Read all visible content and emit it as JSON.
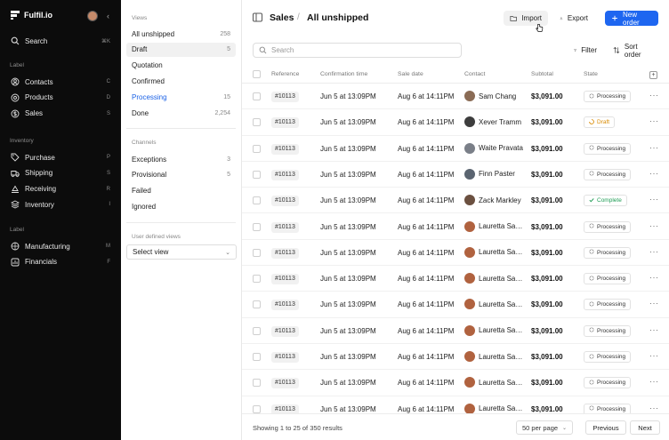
{
  "app": {
    "name": "Fulfil.io"
  },
  "sidebar": {
    "search": {
      "label": "Search",
      "shortcut": "⌘K"
    },
    "groups": [
      {
        "label": "Label",
        "items": [
          {
            "label": "Contacts",
            "shortcut": "C",
            "icon": "contacts-icon"
          },
          {
            "label": "Products",
            "shortcut": "D",
            "icon": "products-icon"
          },
          {
            "label": "Sales",
            "shortcut": "S",
            "icon": "sales-icon"
          }
        ]
      },
      {
        "label": "Inventory",
        "items": [
          {
            "label": "Purchase",
            "shortcut": "P",
            "icon": "tag-icon"
          },
          {
            "label": "Shipping",
            "shortcut": "S",
            "icon": "truck-icon"
          },
          {
            "label": "Receiving",
            "shortcut": "R",
            "icon": "receiving-icon"
          },
          {
            "label": "Inventory",
            "shortcut": "I",
            "icon": "stack-icon"
          }
        ]
      },
      {
        "label": "Label",
        "items": [
          {
            "label": "Manufacturing",
            "shortcut": "M",
            "icon": "factory-icon"
          },
          {
            "label": "Financials",
            "shortcut": "F",
            "icon": "chart-icon"
          }
        ]
      }
    ]
  },
  "views": {
    "views_label": "Views",
    "items": [
      {
        "label": "All unshipped",
        "count": "258"
      },
      {
        "label": "Draft",
        "count": "5"
      },
      {
        "label": "Quotation",
        "count": ""
      },
      {
        "label": "Confirmed",
        "count": ""
      },
      {
        "label": "Processing",
        "count": "15"
      },
      {
        "label": "Done",
        "count": "2,254"
      }
    ],
    "channels_label": "Channels",
    "channels": [
      {
        "label": "Exceptions",
        "count": "3"
      },
      {
        "label": "Provisional",
        "count": "5"
      },
      {
        "label": "Failed",
        "count": ""
      },
      {
        "label": "Ignored",
        "count": ""
      }
    ],
    "user_views_label": "User defined views",
    "select_view": "Select view"
  },
  "header": {
    "section": "Sales",
    "separator": "/",
    "title": "All unshipped",
    "import_label": "Import",
    "export_label": "Export",
    "new_order_label": "New order",
    "search_placeholder": "Search",
    "filter_label": "Filter",
    "sort_label": "Sort order"
  },
  "table": {
    "columns": [
      "Reference",
      "Confirmation time",
      "Sale date",
      "Contact",
      "Subtotal",
      "State"
    ],
    "rows": [
      {
        "ref": "#10113",
        "conf": "Jun 5 at 13:09PM",
        "sale": "Aug 6 at 14:11PM",
        "contact": "Sam Chang",
        "subtotal": "$3,091.00",
        "state": "Processing",
        "avatar": "#8a6b55"
      },
      {
        "ref": "#10113",
        "conf": "Jun 5 at 13:09PM",
        "sale": "Aug 6 at 14:11PM",
        "contact": "Xever Tramm",
        "subtotal": "$3,091.00",
        "state": "Draft",
        "avatar": "#3d3d3d"
      },
      {
        "ref": "#10113",
        "conf": "Jun 5 at 13:09PM",
        "sale": "Aug 6 at 14:11PM",
        "contact": "Waite Pravata",
        "subtotal": "$3,091.00",
        "state": "Processing",
        "avatar": "#7a7f88"
      },
      {
        "ref": "#10113",
        "conf": "Jun 5 at 13:09PM",
        "sale": "Aug 6 at 14:11PM",
        "contact": "Finn Paster",
        "subtotal": "$3,091.00",
        "state": "Processing",
        "avatar": "#5a6470"
      },
      {
        "ref": "#10113",
        "conf": "Jun 5 at 13:09PM",
        "sale": "Aug 6 at 14:11PM",
        "contact": "Zack Markley",
        "subtotal": "$3,091.00",
        "state": "Complete",
        "avatar": "#6b5040"
      },
      {
        "ref": "#10113",
        "conf": "Jun 5 at 13:09PM",
        "sale": "Aug 6 at 14:11PM",
        "contact": "Lauretta Savage",
        "subtotal": "$3,091.00",
        "state": "Processing",
        "avatar": "#b0623f"
      },
      {
        "ref": "#10113",
        "conf": "Jun 5 at 13:09PM",
        "sale": "Aug 6 at 14:11PM",
        "contact": "Lauretta Savage",
        "subtotal": "$3,091.00",
        "state": "Processing",
        "avatar": "#b0623f"
      },
      {
        "ref": "#10113",
        "conf": "Jun 5 at 13:09PM",
        "sale": "Aug 6 at 14:11PM",
        "contact": "Lauretta Savage",
        "subtotal": "$3,091.00",
        "state": "Processing",
        "avatar": "#b0623f"
      },
      {
        "ref": "#10113",
        "conf": "Jun 5 at 13:09PM",
        "sale": "Aug 6 at 14:11PM",
        "contact": "Lauretta Savage",
        "subtotal": "$3,091.00",
        "state": "Processing",
        "avatar": "#b0623f"
      },
      {
        "ref": "#10113",
        "conf": "Jun 5 at 13:09PM",
        "sale": "Aug 6 at 14:11PM",
        "contact": "Lauretta Savage",
        "subtotal": "$3,091.00",
        "state": "Processing",
        "avatar": "#b0623f"
      },
      {
        "ref": "#10113",
        "conf": "Jun 5 at 13:09PM",
        "sale": "Aug 6 at 14:11PM",
        "contact": "Lauretta Savage",
        "subtotal": "$3,091.00",
        "state": "Processing",
        "avatar": "#b0623f"
      },
      {
        "ref": "#10113",
        "conf": "Jun 5 at 13:09PM",
        "sale": "Aug 6 at 14:11PM",
        "contact": "Lauretta Savage",
        "subtotal": "$3,091.00",
        "state": "Processing",
        "avatar": "#b0623f"
      },
      {
        "ref": "#10113",
        "conf": "Jun 5 at 13:09PM",
        "sale": "Aug 6 at 14:11PM",
        "contact": "Lauretta Savage",
        "subtotal": "$3,091.00",
        "state": "Processing",
        "avatar": "#b0623f"
      }
    ]
  },
  "footer": {
    "results": "Showing 1 to 25 of 350 results",
    "per_page": "50 per page",
    "prev_label": "Previous",
    "next_label": "Next"
  },
  "colors": {
    "accent": "#1e66f0",
    "complete": "#1f9d55",
    "draft": "#d98a00"
  }
}
